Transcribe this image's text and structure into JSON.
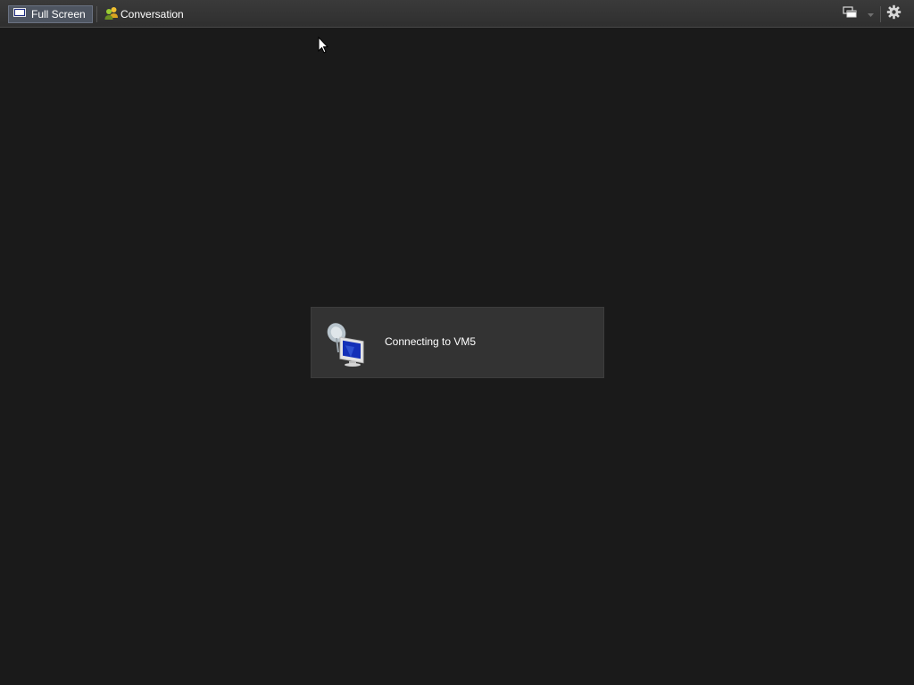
{
  "toolbar": {
    "fullscreen_label": "Full Screen",
    "conversation_label": "Conversation"
  },
  "dialog": {
    "message": "Connecting to VM5"
  },
  "colors": {
    "background": "#1a1a1a",
    "toolbar": "#333333",
    "dialog": "#333333",
    "text": "#ffffff",
    "active_button": "#4e5561"
  },
  "icons": {
    "fullscreen": "monitor-icon",
    "conversation": "people-icon",
    "window_switch": "windows-icon",
    "dropdown": "chevron-down-icon",
    "settings": "gear-icon",
    "connecting": "remote-connection-icon",
    "cursor": "mouse-pointer-icon"
  }
}
